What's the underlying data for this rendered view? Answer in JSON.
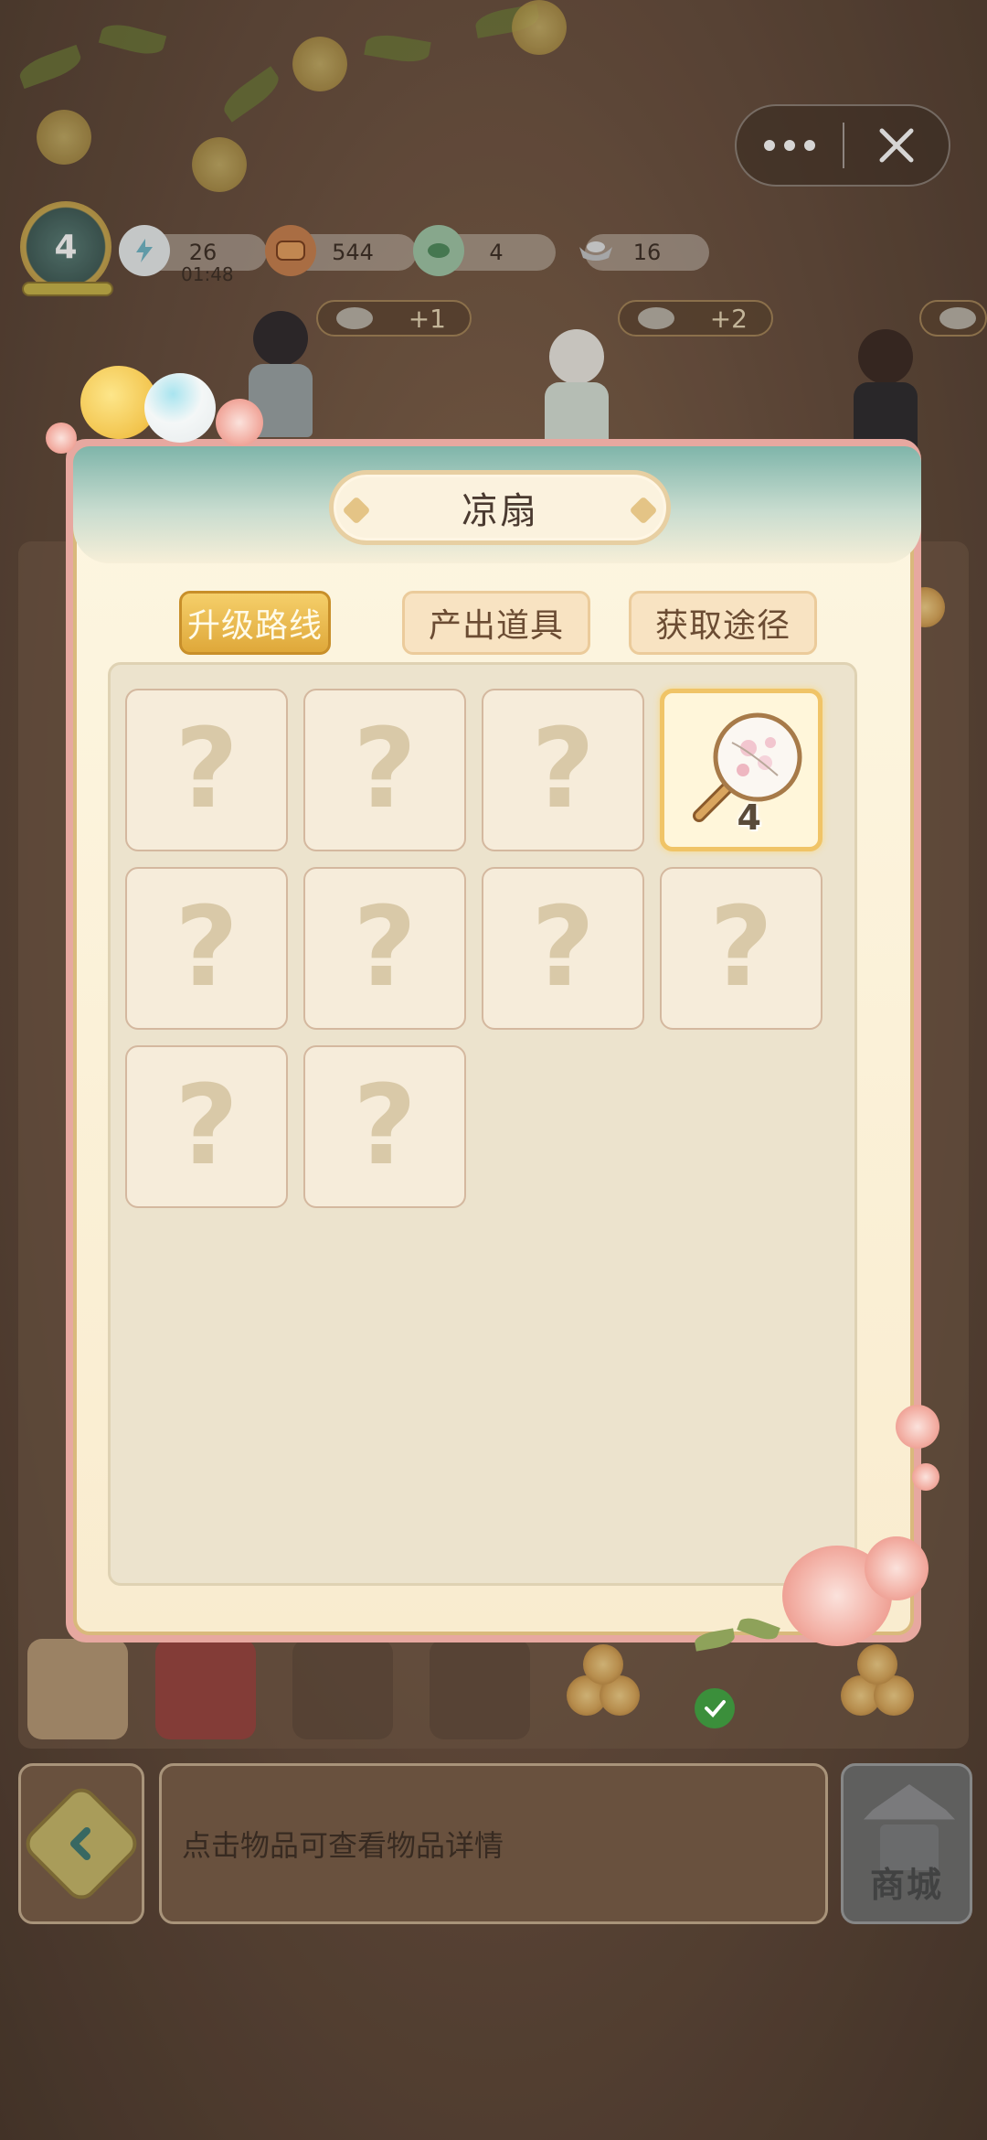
{
  "header": {
    "level": "4",
    "resources": [
      {
        "icon": "lightning-cloud-icon",
        "value": "26"
      },
      {
        "icon": "wallet-icon",
        "value": "544"
      },
      {
        "icon": "leaf-coin-icon",
        "value": "4"
      },
      {
        "icon": "silver-ingot-icon",
        "value": "16"
      }
    ],
    "timer": "01:48",
    "bonuses": [
      "+1",
      "+2"
    ]
  },
  "modal": {
    "title": "凉扇",
    "tabs": [
      {
        "label": "升级路线",
        "active": true
      },
      {
        "label": "产出道具",
        "active": false
      },
      {
        "label": "获取途径",
        "active": false
      }
    ],
    "items": [
      {
        "state": "locked",
        "symbol": "?"
      },
      {
        "state": "locked",
        "symbol": "?"
      },
      {
        "state": "locked",
        "symbol": "?"
      },
      {
        "state": "owned",
        "icon": "round-fan-icon",
        "level": "4"
      },
      {
        "state": "locked",
        "symbol": "?"
      },
      {
        "state": "locked",
        "symbol": "?"
      },
      {
        "state": "locked",
        "symbol": "?"
      },
      {
        "state": "locked",
        "symbol": "?"
      },
      {
        "state": "locked",
        "symbol": "?"
      },
      {
        "state": "locked",
        "symbol": "?"
      }
    ]
  },
  "bottom_bar": {
    "hint": "点击物品可查看物品详情",
    "shop_label": "商城"
  },
  "colors": {
    "active_tab": "#e2ad3f",
    "modal_border": "#e7a8a0",
    "header_teal": "#7fb5aa",
    "cell_bg": "#f6ecda",
    "owned_border": "#f0c467"
  }
}
